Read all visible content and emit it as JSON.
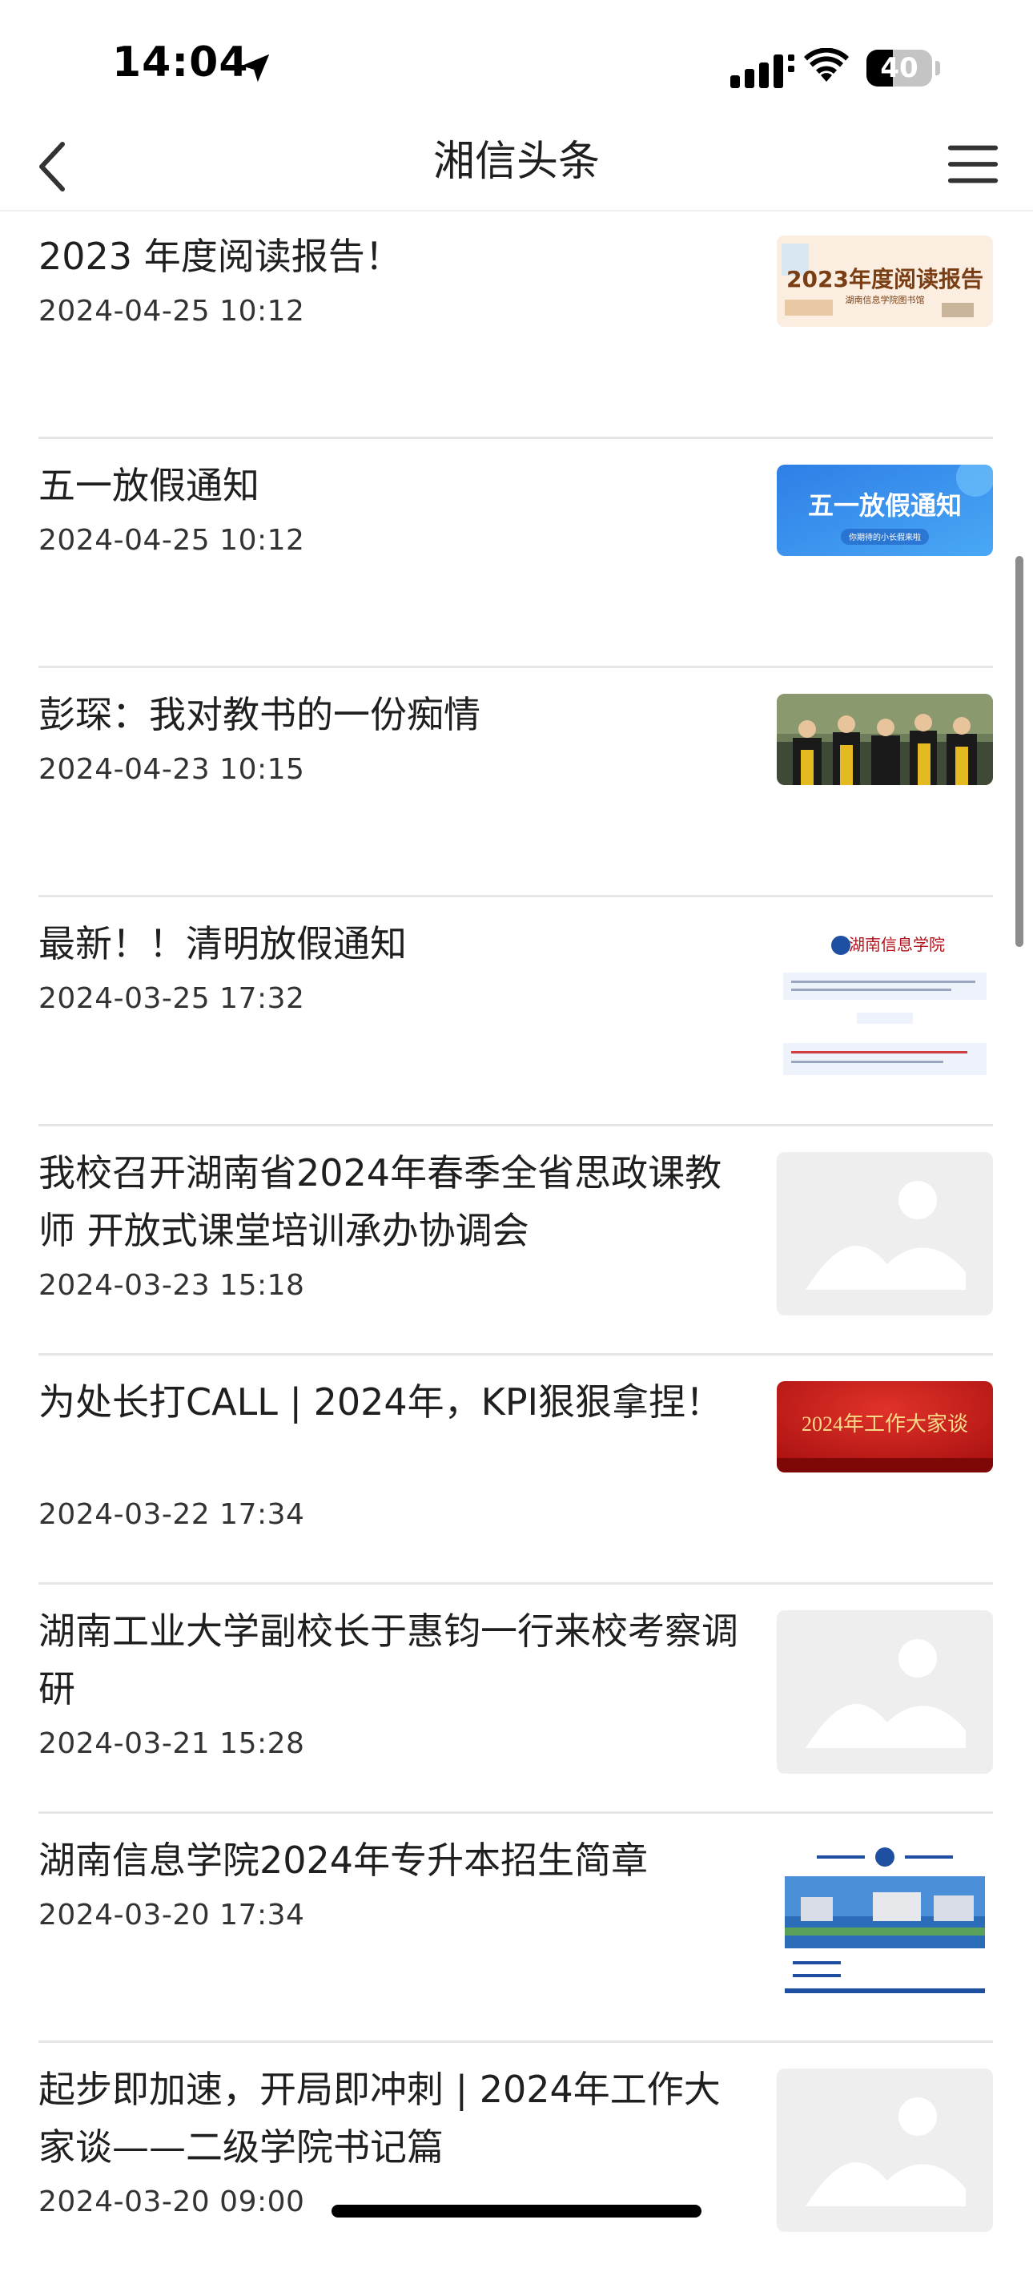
{
  "status_bar": {
    "time": "14:04",
    "battery_level": "40",
    "battery_fraction": 0.4,
    "icons": [
      "location-arrow-icon",
      "cellular-signal-icon",
      "wifi-icon",
      "battery-icon"
    ]
  },
  "nav": {
    "title": "湘信头条",
    "back_icon": "chevron-left-icon",
    "menu_icon": "hamburger-menu-icon"
  },
  "news": [
    {
      "title": "2023 年度阅读报告！",
      "date": "2024-04-25 10:12",
      "thumb": "reading-report-image",
      "thumb_text": "2023年度阅读报告",
      "thumb_sub": "湖南信息学院图书馆"
    },
    {
      "title": "五一放假通知",
      "date": "2024-04-25 10:12",
      "thumb": "mayday-notice-image",
      "thumb_text": "五一放假通知",
      "thumb_sub": "你期待的小长假来啦"
    },
    {
      "title": "彭琛：我对教书的一份痴情",
      "date": "2024-04-23 10:15",
      "thumb": "graduation-photo-image"
    },
    {
      "title": "最新！！清明放假通知",
      "date": "2024-03-25 17:32",
      "thumb": "school-notice-image",
      "thumb_text": "湖南信息学院"
    },
    {
      "title": "我校召开湖南省2024年春季全省思政课教师 开放式课堂培训承办协调会",
      "date": "2024-03-23 15:18",
      "thumb": "placeholder-image"
    },
    {
      "title": "为处长打CALL | 2024年，KPI狠狠拿捏！",
      "date": "2024-03-22 17:34",
      "thumb": "work-talk-banner-image",
      "thumb_text": "2024年工作大家谈"
    },
    {
      "title": "湖南工业大学副校长于惠钧一行来校考察调研",
      "date": "2024-03-21 15:28",
      "thumb": "placeholder-image"
    },
    {
      "title": "湖南信息学院2024年专升本招生简章",
      "date": "2024-03-20 17:34",
      "thumb": "campus-admission-image"
    },
    {
      "title": "起步即加速，开局即冲刺 | 2024年工作大家谈——二级学院书记篇",
      "date": "2024-03-20 09:00",
      "thumb": "placeholder-image"
    }
  ]
}
